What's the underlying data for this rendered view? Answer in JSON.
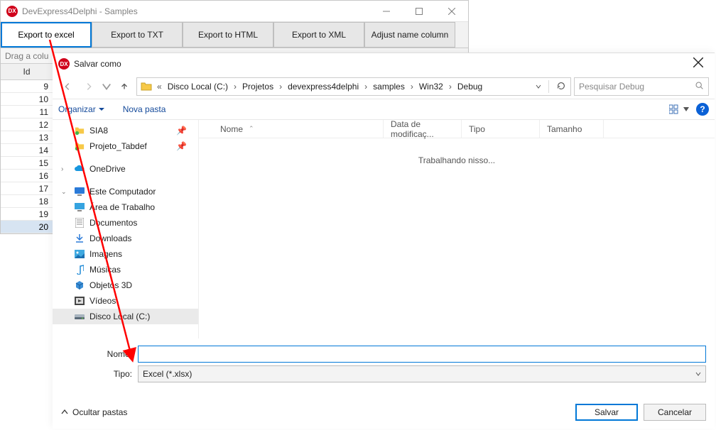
{
  "window": {
    "title": "DevExpress4Delphi - Samples",
    "icon_label": "DX"
  },
  "toolbar": {
    "export_excel": "Export to excel",
    "export_txt": "Export to TXT",
    "export_html": "Export to HTML",
    "export_xml": "Export to XML",
    "adjust_col": "Adjust name column"
  },
  "grid": {
    "group_hint_prefix": "Drag a colu",
    "header_id": "Id",
    "rows": [
      "9",
      "10",
      "11",
      "12",
      "13",
      "14",
      "15",
      "16",
      "17",
      "18",
      "19",
      "20"
    ]
  },
  "dialog": {
    "title": "Salvar como",
    "icon_label": "DX",
    "breadcrumbs": [
      "Disco Local (C:)",
      "Projetos",
      "devexpress4delphi",
      "samples",
      "Win32",
      "Debug"
    ],
    "search_placeholder": "Pesquisar Debug",
    "organize": "Organizar",
    "new_folder": "Nova pasta",
    "help_glyph": "?",
    "tree": {
      "sia8": "SIA8",
      "tabdef": "Projeto_Tabdef",
      "onedrive": "OneDrive",
      "computer": "Este Computador",
      "desktop": "Área de Trabalho",
      "documents": "Documentos",
      "downloads": "Downloads",
      "images": "Imagens",
      "music": "Músicas",
      "objects3d": "Objetos 3D",
      "videos": "Vídeos",
      "local_c": "Disco Local (C:)"
    },
    "file_cols": {
      "name": "Nome",
      "date": "Data de modificaç...",
      "type": "Tipo",
      "size": "Tamanho"
    },
    "working_msg": "Trabalhando nisso...",
    "filename_label": "Nome:",
    "filetype_label": "Tipo:",
    "filename_value": "",
    "filetype_value": "Excel (*.xlsx)",
    "hide_folders": "Ocultar pastas",
    "save": "Salvar",
    "cancel": "Cancelar"
  }
}
